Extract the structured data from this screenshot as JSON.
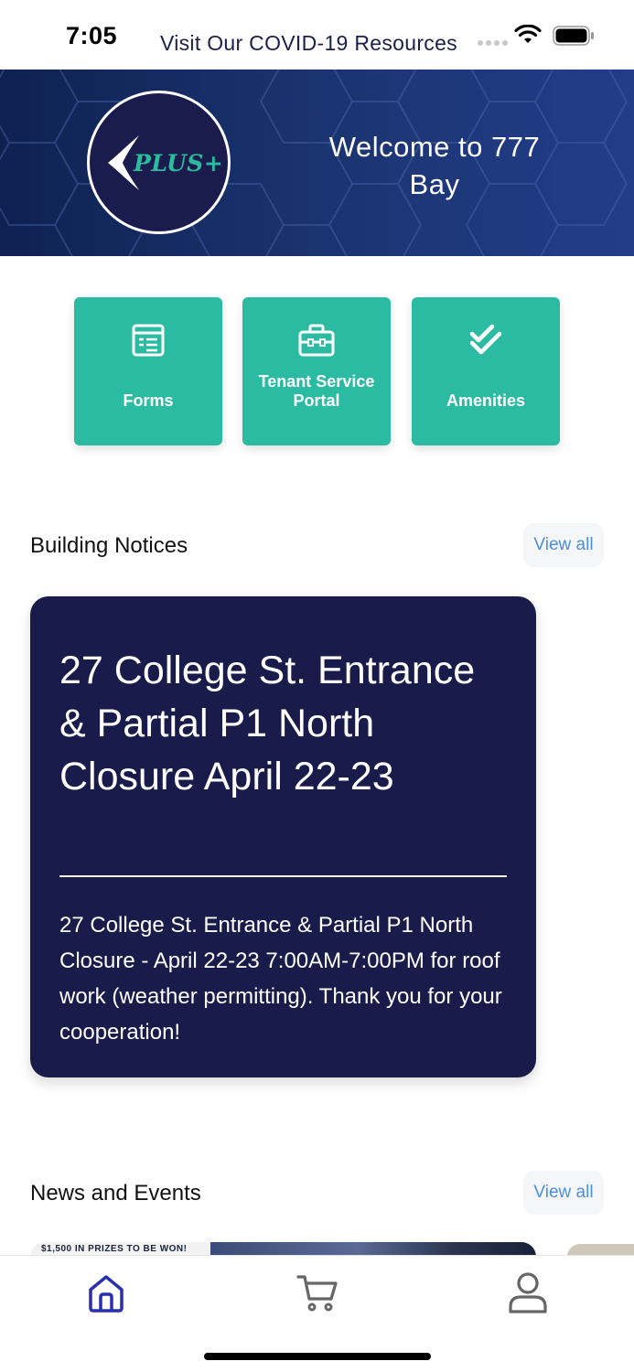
{
  "status_bar": {
    "time": "7:05",
    "banner": "Visit Our COVID-19 Resources"
  },
  "hero": {
    "logo_text": "PLUS+",
    "welcome": "Welcome to 777 Bay",
    "accent_color": "#2bbba3"
  },
  "quick_actions": [
    {
      "label": "Forms",
      "icon": "form-icon"
    },
    {
      "label": "Tenant Service Portal",
      "icon": "toolbox-icon"
    },
    {
      "label": "Amenities",
      "icon": "double-check-icon"
    }
  ],
  "building_notices": {
    "title": "Building Notices",
    "view_all": "View all",
    "card": {
      "title": "27 College St. Entrance & Partial P1 North Closure April 22-23",
      "body": "27 College St. Entrance & Partial P1 North Closure - April 22-23 7:00AM-7:00PM for roof work (weather permitting). Thank you for your cooperation!"
    }
  },
  "news_events": {
    "title": "News and Events",
    "view_all": "View all",
    "preview_text": "$1,500 IN PRIZES TO BE WON!"
  },
  "tab_bar": {
    "tabs": [
      {
        "name": "home",
        "icon": "home-icon",
        "active": true
      },
      {
        "name": "cart",
        "icon": "cart-icon",
        "active": false
      },
      {
        "name": "profile",
        "icon": "user-icon",
        "active": false
      }
    ],
    "active_color": "#2a2fb0"
  }
}
